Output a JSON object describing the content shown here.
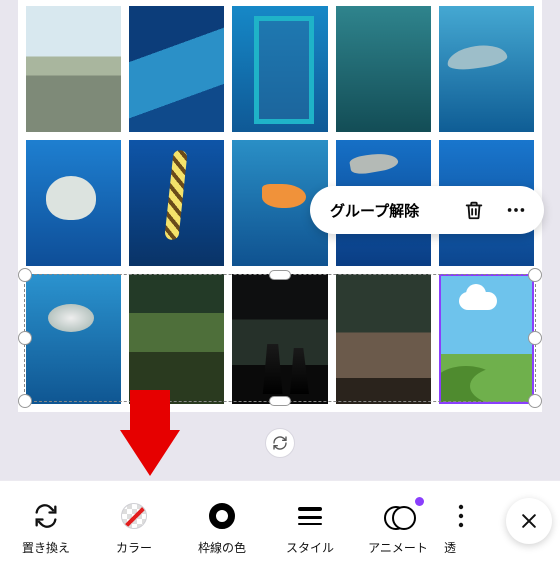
{
  "context_menu": {
    "ungroup_label": "グループ解除",
    "delete_icon": "trash-icon",
    "more_icon": "more-icon"
  },
  "toolbar": {
    "items": [
      {
        "label": "置き換え",
        "icon": "replace-icon"
      },
      {
        "label": "カラー",
        "icon": "color-icon"
      },
      {
        "label": "枠線の色",
        "icon": "border-color-icon"
      },
      {
        "label": "スタイル",
        "icon": "style-icon"
      },
      {
        "label": "アニメート",
        "icon": "animate-icon"
      }
    ],
    "overflow_label_partial": "透",
    "close_icon": "close-icon"
  },
  "sync_icon": "sync-icon",
  "grid": {
    "rows": 3,
    "cols": 5,
    "selected_row": 2,
    "placeholder_cell": {
      "row": 2,
      "col": 4
    }
  },
  "annotation": {
    "arrow_points_to": "toolbar.items.1"
  }
}
